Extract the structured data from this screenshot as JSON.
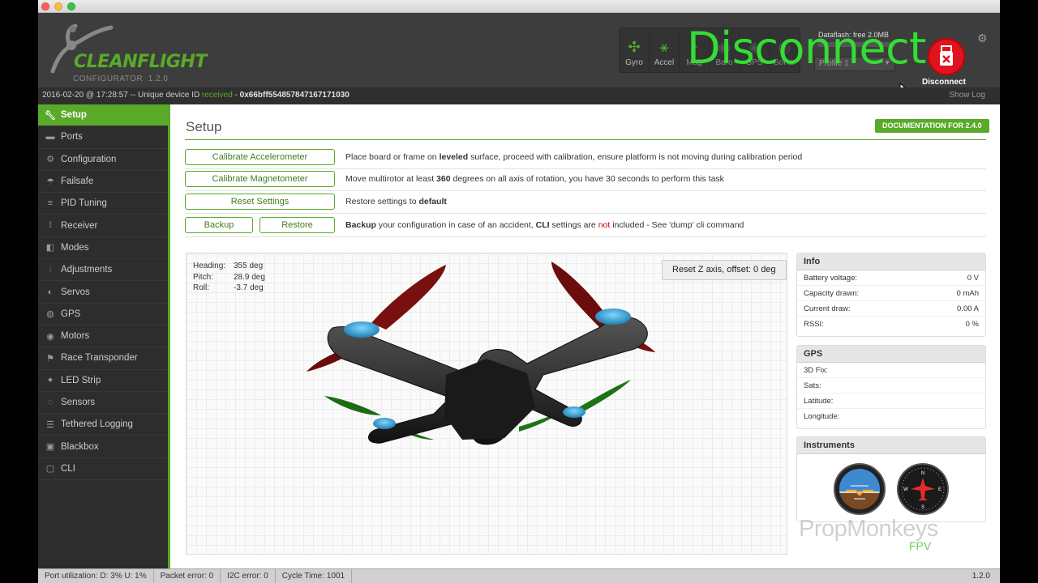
{
  "app": {
    "brand": "CLEANFLIGHT",
    "configurator_label": "CONFIGURATOR",
    "version": "1.2.0"
  },
  "header": {
    "sensors": [
      {
        "name": "Gyro",
        "icon": "gyro-icon",
        "active": true
      },
      {
        "name": "Accel",
        "icon": "accel-icon",
        "active": true
      },
      {
        "name": "Mag",
        "icon": "mag-icon",
        "active": false
      },
      {
        "name": "Baro",
        "icon": "baro-icon",
        "active": false
      },
      {
        "name": "GPS",
        "icon": "gps-icon",
        "active": false
      },
      {
        "name": "Sonar",
        "icon": "sonar-icon",
        "active": false
      }
    ],
    "dataflash_label": "Dataflash: free 2.0MB",
    "profile_value": "Profile 1",
    "disconnect_overlay": "Disconnect",
    "disconnect_label": "Disconnect"
  },
  "logbar": {
    "timestamp": "2016-02-20 @ 17:28:57",
    "sep1": "-- Unique device ID",
    "status": "received",
    "sep2": "-",
    "device_id": "0x66bff554857847167171030",
    "show_log": "Show Log"
  },
  "sidebar": {
    "items": [
      {
        "label": "Setup",
        "icon": "wrench-icon",
        "active": true
      },
      {
        "label": "Ports",
        "icon": "ports-icon"
      },
      {
        "label": "Configuration",
        "icon": "gear-icon"
      },
      {
        "label": "Failsafe",
        "icon": "failsafe-icon"
      },
      {
        "label": "PID Tuning",
        "icon": "sliders-icon"
      },
      {
        "label": "Receiver",
        "icon": "receiver-icon"
      },
      {
        "label": "Modes",
        "icon": "modes-icon"
      },
      {
        "label": "Adjustments",
        "icon": "adjustments-icon"
      },
      {
        "label": "Servos",
        "icon": "servo-icon"
      },
      {
        "label": "GPS",
        "icon": "gps-pin-icon"
      },
      {
        "label": "Motors",
        "icon": "motor-icon"
      },
      {
        "label": "Race Transponder",
        "icon": "transponder-icon"
      },
      {
        "label": "LED Strip",
        "icon": "led-icon"
      },
      {
        "label": "Sensors",
        "icon": "sensors-icon"
      },
      {
        "label": "Tethered Logging",
        "icon": "logging-icon"
      },
      {
        "label": "Blackbox",
        "icon": "blackbox-icon"
      },
      {
        "label": "CLI",
        "icon": "terminal-icon"
      }
    ]
  },
  "setup": {
    "title": "Setup",
    "documentation_button": "DOCUMENTATION FOR 2.4.0",
    "actions": {
      "calibrate_acc": "Calibrate Accelerometer",
      "calibrate_acc_desc_pre": "Place board or frame on ",
      "calibrate_acc_desc_bold": "leveled",
      "calibrate_acc_desc_post": " surface, proceed with calibration, ensure platform is not moving during calibration period",
      "calibrate_mag": "Calibrate Magnetometer",
      "calibrate_mag_desc_pre": "Move multirotor at least ",
      "calibrate_mag_desc_bold": "360",
      "calibrate_mag_desc_post": " degrees on all axis of rotation, you have 30 seconds to perform this task",
      "reset_settings": "Reset Settings",
      "reset_desc_pre": "Restore settings to ",
      "reset_desc_bold": "default",
      "backup": "Backup",
      "restore": "Restore",
      "backup_desc_b1": "Backup",
      "backup_desc_1": " your configuration in case of an accident, ",
      "backup_desc_b2": "CLI",
      "backup_desc_2": " settings are ",
      "backup_desc_red": "not",
      "backup_desc_3": " included - See 'dump' cli command"
    },
    "attitude": {
      "heading_label": "Heading:",
      "heading_value": "355 deg",
      "pitch_label": "Pitch:",
      "pitch_value": "28.9 deg",
      "roll_label": "Roll:",
      "roll_value": "-3.7 deg"
    },
    "reset_z": "Reset Z axis, offset: 0 deg"
  },
  "info_panel": {
    "title": "Info",
    "rows": [
      {
        "label": "Battery voltage:",
        "value": "0 V"
      },
      {
        "label": "Capacity drawn:",
        "value": "0 mAh"
      },
      {
        "label": "Current draw:",
        "value": "0.00 A"
      },
      {
        "label": "RSSI:",
        "value": "0 %"
      }
    ]
  },
  "gps_panel": {
    "title": "GPS",
    "rows": [
      {
        "label": "3D Fix:",
        "value": ""
      },
      {
        "label": "Sats:",
        "value": ""
      },
      {
        "label": "Latitude:",
        "value": ""
      },
      {
        "label": "Longitude:",
        "value": ""
      }
    ]
  },
  "instruments_panel": {
    "title": "Instruments"
  },
  "statusbar": {
    "port_util": "Port utilization: D: 3% U: 1%",
    "packet_error": "Packet error: 0",
    "i2c_error": "I2C error: 0",
    "cycle_time": "Cycle Time: 1001",
    "version": "1.2.0"
  },
  "watermark": {
    "text": "PropMonkeys",
    "sub": "FPV"
  },
  "colors": {
    "accent": "#59aa29",
    "header_bg": "#3d3d3d",
    "disconnect_red": "#e0141e",
    "overlay_text": "#33dd33"
  }
}
